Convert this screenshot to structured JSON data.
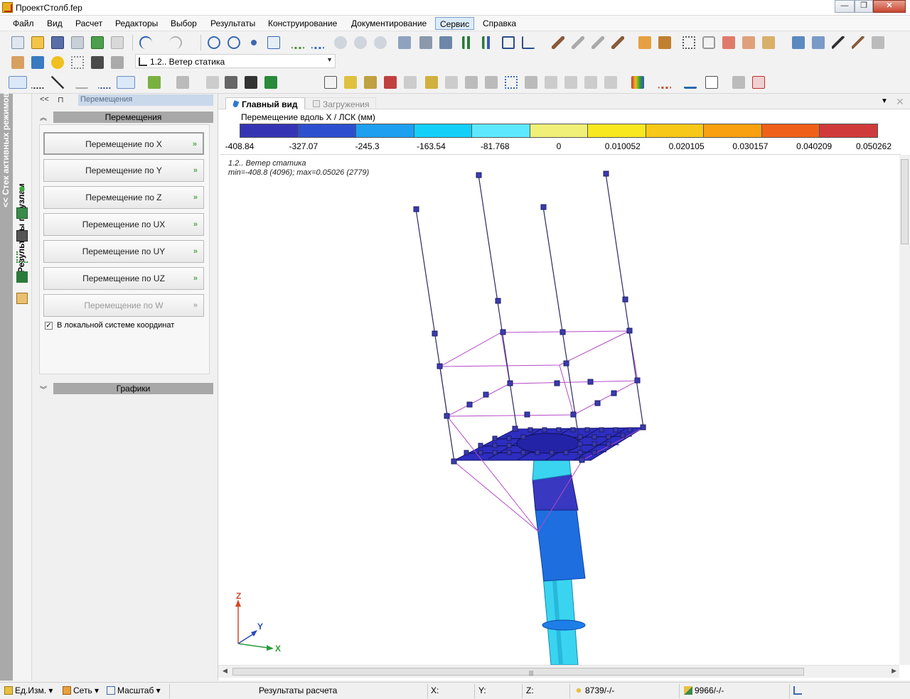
{
  "window": {
    "title": "ПроектСтолб.fep",
    "minimize": "—",
    "maximize": "❐",
    "close": "✕"
  },
  "menu": [
    "Файл",
    "Вид",
    "Расчет",
    "Редакторы",
    "Выбор",
    "Результаты",
    "Конструирование",
    "Документирование",
    "Сервис",
    "Справка"
  ],
  "menu_active": "Сервис",
  "toolbar": {
    "load_case": "1.2.. Ветер статика"
  },
  "left_strip": {
    "active_modes_label": "<< Стек активных режимов",
    "node_results_label": "Результаты по узлам"
  },
  "panel": {
    "nav_back": "<<",
    "nav_pin": "⊓",
    "breadcrumb": "Перемещения",
    "group_title": "Перемещения",
    "buttons": [
      {
        "label": "Перемещение по X",
        "enabled": true
      },
      {
        "label": "Перемещение по Y",
        "enabled": true
      },
      {
        "label": "Перемещение по Z",
        "enabled": true
      },
      {
        "label": "Перемещение по UX",
        "enabled": true
      },
      {
        "label": "Перемещение по UY",
        "enabled": true
      },
      {
        "label": "Перемещение по UZ",
        "enabled": true
      },
      {
        "label": "Перемещение по W",
        "enabled": false
      }
    ],
    "arrow": "»",
    "checkbox_label": "В локальной системе координат",
    "checkbox_checked": true,
    "graphs_title": "Графики"
  },
  "view": {
    "tab_main": "Главный вид",
    "tab_loads": "Загружения",
    "legend_title": "Перемещение вдоль X / ЛСК (мм)",
    "legend_labels": [
      "-408.84",
      "-327.07",
      "-245.3",
      "-163.54",
      "-81.768",
      "0",
      "0.010052",
      "0.020105",
      "0.030157",
      "0.040209",
      "0.050262"
    ],
    "legend_colors": [
      "#3535b4",
      "#2c4fd0",
      "#1e9ff0",
      "#14d0f8",
      "#5ee8ff",
      "#f0f078",
      "#f8e820",
      "#f8c818",
      "#f8a010",
      "#f06018",
      "#d03a3a"
    ],
    "info_case": "1.2.. Ветер статика",
    "info_minmax": "min=-408.8 (4096); max=0.05026 (2779)",
    "axes": {
      "x": "X",
      "y": "Y",
      "z": "Z"
    }
  },
  "status": {
    "units": "Ед.Изм.",
    "net": "Сеть",
    "scale": "Масштаб",
    "mode": "Результаты расчета",
    "x": "X:",
    "y": "Y:",
    "z": "Z:",
    "nodes": "8739/-/-",
    "elements": "9966/-/-"
  }
}
